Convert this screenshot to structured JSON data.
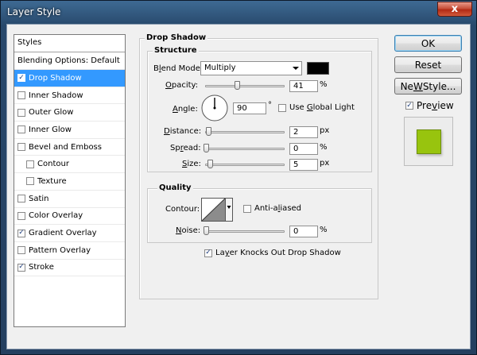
{
  "window": {
    "title": "Layer Style",
    "close_glyph": "x"
  },
  "styles_panel": {
    "header": "Styles",
    "blending_default": "Blending Options: Default",
    "items": [
      {
        "label": "Drop Shadow",
        "checked": true,
        "selected": true,
        "sub": false
      },
      {
        "label": "Inner Shadow",
        "checked": false,
        "selected": false,
        "sub": false
      },
      {
        "label": "Outer Glow",
        "checked": false,
        "selected": false,
        "sub": false
      },
      {
        "label": "Inner Glow",
        "checked": false,
        "selected": false,
        "sub": false
      },
      {
        "label": "Bevel and Emboss",
        "checked": false,
        "selected": false,
        "sub": false
      },
      {
        "label": "Contour",
        "checked": false,
        "selected": false,
        "sub": true
      },
      {
        "label": "Texture",
        "checked": false,
        "selected": false,
        "sub": true
      },
      {
        "label": "Satin",
        "checked": false,
        "selected": false,
        "sub": false
      },
      {
        "label": "Color Overlay",
        "checked": false,
        "selected": false,
        "sub": false
      },
      {
        "label": "Gradient Overlay",
        "checked": true,
        "selected": false,
        "sub": false
      },
      {
        "label": "Pattern Overlay",
        "checked": false,
        "selected": false,
        "sub": false
      },
      {
        "label": "Stroke",
        "checked": true,
        "selected": false,
        "sub": false
      }
    ]
  },
  "drop_shadow": {
    "title": "Drop Shadow",
    "structure": {
      "title": "Structure",
      "blend_mode_label_pre": "B",
      "blend_mode_label_u": "l",
      "blend_mode_label_post": "end Mode:",
      "blend_mode_value": "Multiply",
      "shadow_color": "#000000",
      "opacity_label_u": "O",
      "opacity_label_post": "pacity:",
      "opacity_value": "41",
      "opacity_level": 0.41,
      "opacity_unit": "%",
      "angle_label_u": "A",
      "angle_label_post": "ngle:",
      "angle_value": "90",
      "angle_unit": "°",
      "use_global_light_pre": "Use ",
      "use_global_light_u": "G",
      "use_global_light_post": "lobal Light",
      "use_global_light_checked": false,
      "distance_label_u": "D",
      "distance_label_post": "istance:",
      "distance_value": "2",
      "distance_unit": "px",
      "spread_label_pre": "Sp",
      "spread_label_u": "r",
      "spread_label_post": "ead:",
      "spread_value": "0",
      "spread_unit": "%",
      "size_label_u": "S",
      "size_label_post": "ize:",
      "size_value": "5",
      "size_unit": "px"
    },
    "quality": {
      "title": "Quality",
      "contour_label": "Contour:",
      "anti_aliased_pre": "Anti-a",
      "anti_aliased_u": "l",
      "anti_aliased_post": "iased",
      "anti_aliased_checked": false,
      "noise_label_u": "N",
      "noise_label_post": "oise:",
      "noise_value": "0",
      "noise_unit": "%"
    },
    "knockout_label_pre": "La",
    "knockout_label_u": "y",
    "knockout_label_post": "er Knocks Out Drop Shadow",
    "knockout_checked": true
  },
  "buttons": {
    "ok": "OK",
    "reset": "Reset",
    "new_style_u": "W",
    "new_style_pre": "Ne",
    "new_style_post": " Style...",
    "preview_pre": "Pre",
    "preview_u": "v",
    "preview_post": "iew",
    "preview_checked": true
  },
  "preview": {
    "fill_color": "#98c40e"
  }
}
